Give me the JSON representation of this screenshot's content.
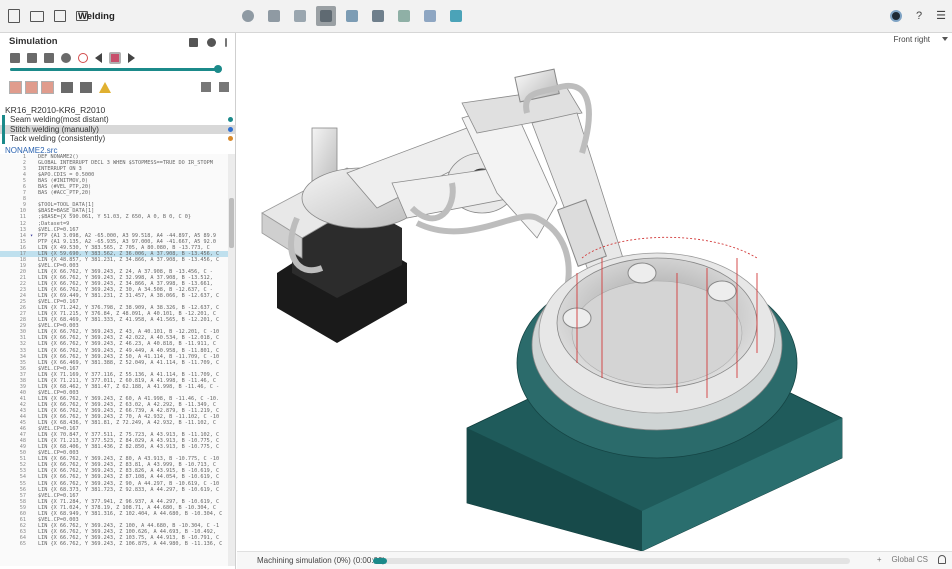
{
  "document": {
    "title": "Welding"
  },
  "panel": {
    "title": "Simulation",
    "progress": 0.98,
    "robot_name": "KR16_R2010-KR6_R2010",
    "operations": [
      {
        "label": "Seam welding(most distant)",
        "color": "#1b8a8a",
        "selected": false
      },
      {
        "label": "Stitch welding (manually)",
        "color": "#2f6fd0",
        "selected": true
      },
      {
        "label": "Tack welding (consistently)",
        "color": "#d98a2b",
        "selected": false
      }
    ],
    "file_name": "NONAME2.src"
  },
  "code_lines": [
    {
      "n": "1",
      "m": "",
      "t": "DEF NONAME2()"
    },
    {
      "n": "2",
      "m": "",
      "t": "GLOBAL INTERRUPT DECL 3 WHEN $STOPMESS==TRUE DO IR_STOPM"
    },
    {
      "n": "3",
      "m": "",
      "t": "INTERRUPT ON 3"
    },
    {
      "n": "4",
      "m": "",
      "t": "$APO.CDIS = 0.5000"
    },
    {
      "n": "5",
      "m": "",
      "t": "BAS (#INITMOV,0)"
    },
    {
      "n": "6",
      "m": "",
      "t": "BAS (#VEL_PTP,20)"
    },
    {
      "n": "7",
      "m": "",
      "t": "BAS (#ACC_PTP,20)"
    },
    {
      "n": "8",
      "m": "",
      "t": ""
    },
    {
      "n": "9",
      "m": "",
      "t": "$TOOL=TOOL_DATA[1]"
    },
    {
      "n": "10",
      "m": "",
      "t": "$BASE=BASE_DATA[1]"
    },
    {
      "n": "11",
      "m": "",
      "t": ";$BASE={X 590.061, Y 51.03, Z 650, A 0, B 0, C 0}"
    },
    {
      "n": "12",
      "m": "",
      "t": ";Dataset=9"
    },
    {
      "n": "13",
      "m": "",
      "t": "$VEL.CP=0.167"
    },
    {
      "n": "14",
      "m": "▾",
      "t": "PTP {A1 3.098, A2 -65.000, A3 99.518, A4 -44.897, A5 89.9"
    },
    {
      "n": "15",
      "m": "",
      "t": "PTP {A1 9.135, A2 -65.935, A3 97.000, A4 -41.667, A5 92.0"
    },
    {
      "n": "16",
      "m": "",
      "t": "LIN {X 49.530, Y 383.565, Z 705, A 80.080, B -13.773, C"
    },
    {
      "n": "17",
      "m": "",
      "t": "LIN {X 59.690, Y 383.562, Z 36.006, A 37.908, B -13.456, C",
      "hl": true
    },
    {
      "n": "18",
      "m": "",
      "t": "LIN {X 48.857, Y 381.231, Z 34.866, A 37.908, B -13.456, C"
    },
    {
      "n": "19",
      "m": "",
      "t": "$VEL.CP=0.003"
    },
    {
      "n": "20",
      "m": "",
      "t": "LIN {X 66.762, Y 369.243, Z 24, A 37.908, B -13.456, C -"
    },
    {
      "n": "21",
      "m": "",
      "t": "LIN {X 66.762, Y 369.243, Z 32.998, A 37.908, B -13.512,"
    },
    {
      "n": "22",
      "m": "",
      "t": "LIN {X 66.762, Y 369.243, Z 34.866, A 37.998, B -13.661,"
    },
    {
      "n": "23",
      "m": "",
      "t": "LIN {X 66.762, Y 369.243, Z 30, A 34.508, B -12.637, C -"
    },
    {
      "n": "24",
      "m": "",
      "t": "LIN {X 69.449, Y 381.231, Z 31.457, A 38.066, B -12.637, C"
    },
    {
      "n": "25",
      "m": "",
      "t": "$VEL.CP=0.167"
    },
    {
      "n": "26",
      "m": "",
      "t": "LIN {X 71.242, Y 376.798, Z 38.909, A 38.326, B -12.637, C"
    },
    {
      "n": "27",
      "m": "",
      "t": "LIN {X 71.215, Y 376.84, Z 48.091, A 40.101, B -12.201, C"
    },
    {
      "n": "28",
      "m": "",
      "t": "LIN {X 68.469, Y 381.333, Z 41.958, A 41.565, B -12.201, C"
    },
    {
      "n": "29",
      "m": "",
      "t": "$VEL.CP=0.003"
    },
    {
      "n": "30",
      "m": "",
      "t": "LIN {X 66.762, Y 369.243, Z 43, A 40.101, B -12.201, C -10"
    },
    {
      "n": "31",
      "m": "",
      "t": "LIN {X 66.762, Y 369.243, Z 42.022, A 40.534, B -12.018, C"
    },
    {
      "n": "32",
      "m": "",
      "t": "LIN {X 66.762, Y 369.243, Z 46.23, A 40.818, B -11.911, C"
    },
    {
      "n": "33",
      "m": "",
      "t": "LIN {X 66.762, Y 369.243, Z 49.449, A 40.958, B -11.801, C"
    },
    {
      "n": "34",
      "m": "",
      "t": "LIN {X 66.762, Y 369.243, Z 50, A 41.114, B -11.709, C -10"
    },
    {
      "n": "35",
      "m": "",
      "t": "LIN {X 66.469, Y 381.388, Z 52.049, A 41.114, B -11.709, C"
    },
    {
      "n": "36",
      "m": "",
      "t": "$VEL.CP=0.167"
    },
    {
      "n": "37",
      "m": "",
      "t": "LIN {X 71.169, Y 377.116, Z 55.136, A 41.114, B -11.709, C"
    },
    {
      "n": "38",
      "m": "",
      "t": "LIN {X 71.211, Y 377.011, Z 60.819, A 41.998, B -11.46, C"
    },
    {
      "n": "39",
      "m": "",
      "t": "LIN {X 68.462, Y 381.47, Z 62.188, A 41.998, B -11.46, C -"
    },
    {
      "n": "40",
      "m": "",
      "t": "$VEL.CP=0.003"
    },
    {
      "n": "41",
      "m": "",
      "t": "LIN {X 66.762, Y 369.243, Z 60, A 41.998, B -11.46, C -10."
    },
    {
      "n": "42",
      "m": "",
      "t": "LIN {X 66.762, Y 369.243, Z 63.02, A 42.292, B -11.349, C"
    },
    {
      "n": "43",
      "m": "",
      "t": "LIN {X 66.762, Y 369.243, Z 66.739, A 42.879, B -11.219, C"
    },
    {
      "n": "44",
      "m": "",
      "t": "LIN {X 66.762, Y 369.243, Z 70, A 42.932, B -11.102, C -10"
    },
    {
      "n": "45",
      "m": "",
      "t": "LIN {X 68.436, Y 381.81, Z 72.249, A 42.932, B -11.102, C"
    },
    {
      "n": "46",
      "m": "",
      "t": "$VEL.CP=0.167"
    },
    {
      "n": "47",
      "m": "",
      "t": "LIN {X 70.847, Y 377.511, Z 75.723, A 43.913, B -11.102, C"
    },
    {
      "n": "48",
      "m": "",
      "t": "LIN {X 71.213, Y 377.523, Z 84.029, A 43.913, B -10.775, C"
    },
    {
      "n": "49",
      "m": "",
      "t": "LIN {X 68.406, Y 381.436, Z 82.850, A 43.913, B -10.775, C"
    },
    {
      "n": "50",
      "m": "",
      "t": "$VEL.CP=0.003"
    },
    {
      "n": "51",
      "m": "",
      "t": "LIN {X 66.762, Y 369.243, Z 80, A 43.913, B -10.775, C -10"
    },
    {
      "n": "52",
      "m": "",
      "t": "LIN {X 66.762, Y 369.243, Z 83.81, A 43.999, B -10.713, C"
    },
    {
      "n": "53",
      "m": "",
      "t": "LIN {X 66.762, Y 369.243, Z 83.826, A 43.915, B -10.619, C"
    },
    {
      "n": "54",
      "m": "",
      "t": "LIN {X 66.762, Y 369.243, Z 87.108, A 44.054, B -10.619, C"
    },
    {
      "n": "55",
      "m": "",
      "t": "LIN {X 66.762, Y 369.243, Z 90, A 44.297, B -10.619, C -10"
    },
    {
      "n": "56",
      "m": "",
      "t": "LIN {X 68.373, Y 381.723, Z 92.833, A 44.297, B -10.619, C"
    },
    {
      "n": "57",
      "m": "",
      "t": "$VEL.CP=0.167"
    },
    {
      "n": "58",
      "m": "",
      "t": "LIN {X 71.284, Y 377.941, Z 96.937, A 44.297, B -10.619, C"
    },
    {
      "n": "59",
      "m": "",
      "t": "LIN {X 71.024, Y 378.19, Z 108.71, A 44.680, B -10.304, C"
    },
    {
      "n": "60",
      "m": "",
      "t": "LIN {X 68.949, Y 381.316, Z 102.404, A 44.680, B -10.304, C"
    },
    {
      "n": "61",
      "m": "",
      "t": "$VEL.CP=0.003"
    },
    {
      "n": "62",
      "m": "",
      "t": "LIN {X 66.762, Y 369.243, Z 100, A 44.680, B -10.304, C -1"
    },
    {
      "n": "63",
      "m": "",
      "t": "LIN {X 66.762, Y 369.243, Z 100.626, A 44.693, B -10.492,"
    },
    {
      "n": "64",
      "m": "",
      "t": "LIN {X 66.762, Y 369.243, Z 103.75, A 44.913, B -10.791, C"
    },
    {
      "n": "65",
      "m": "",
      "t": "LIN {X 66.762, Y 369.243, Z 106.875, A 44.980, B -11.136, C"
    }
  ],
  "viewport": {
    "view_name": "Front right"
  },
  "status": {
    "text": "Machining simulation (0%) (0:00:00)",
    "progress": 0.0,
    "coord_system": "Global CS"
  },
  "colors": {
    "accent": "#1b8a8a",
    "table": "#1e5f5f",
    "weld_lines": "#d23a3a"
  }
}
